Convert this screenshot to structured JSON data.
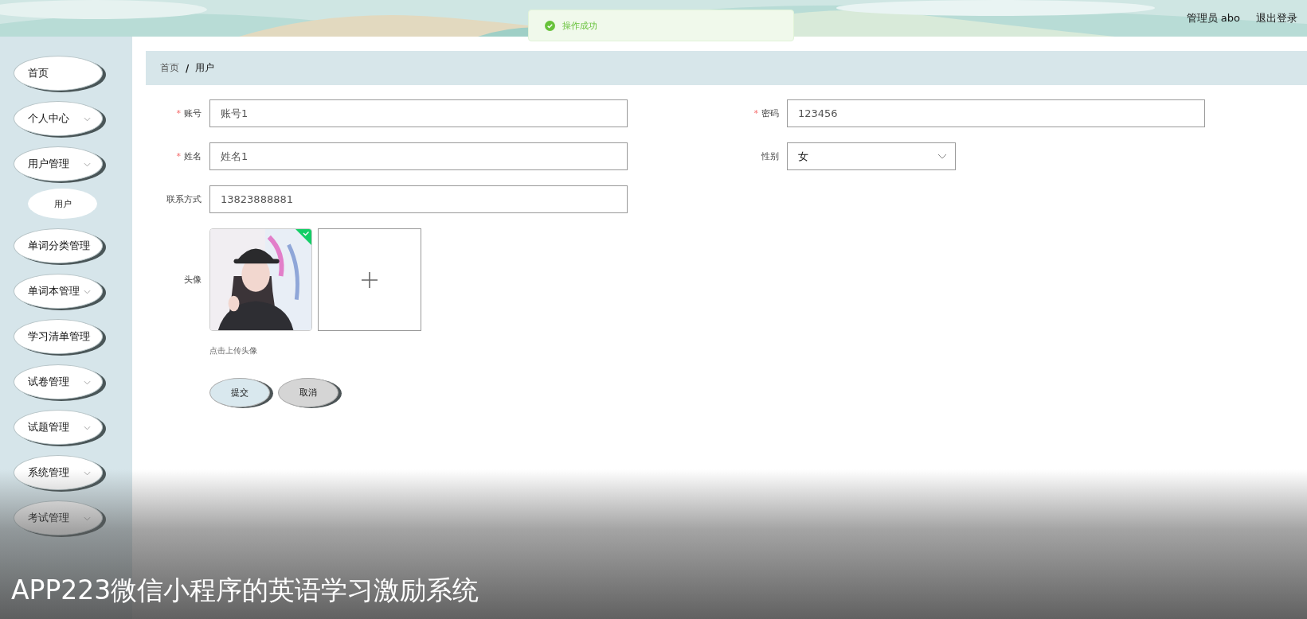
{
  "header": {
    "user": "管理员 abo",
    "logout": "退出登录"
  },
  "toast": {
    "message": "操作成功",
    "kind": "success"
  },
  "sidebar": {
    "items": [
      {
        "label": "首页",
        "kind": "link"
      },
      {
        "label": "个人中心",
        "kind": "submenu"
      },
      {
        "label": "用户管理",
        "kind": "submenu",
        "children": [
          {
            "label": "用户"
          }
        ]
      },
      {
        "label": "单词分类管理",
        "kind": "submenu"
      },
      {
        "label": "单词本管理",
        "kind": "submenu"
      },
      {
        "label": "学习清单管理",
        "kind": "submenu"
      },
      {
        "label": "试卷管理",
        "kind": "submenu"
      },
      {
        "label": "试题管理",
        "kind": "submenu"
      },
      {
        "label": "系统管理",
        "kind": "submenu"
      },
      {
        "label": "考试管理",
        "kind": "submenu"
      }
    ]
  },
  "breadcrumb": {
    "separator": "/",
    "items": [
      "首页",
      "用户"
    ]
  },
  "form": {
    "required_mark": "*",
    "rows": [
      [
        {
          "label": "账号",
          "required": true,
          "kind": "input",
          "value": "账号1"
        },
        {
          "label": "密码",
          "required": true,
          "kind": "input",
          "value": "123456"
        }
      ],
      [
        {
          "label": "姓名",
          "required": true,
          "kind": "input",
          "value": "姓名1"
        },
        {
          "label": "性别",
          "required": false,
          "kind": "select",
          "value": "女"
        }
      ],
      [
        {
          "label": "联系方式",
          "required": false,
          "kind": "input",
          "value": "13823888881"
        }
      ]
    ],
    "avatar": {
      "label": "头像",
      "hint": "点击上传头像"
    },
    "buttons": [
      {
        "label": "提交",
        "kind": "primary"
      },
      {
        "label": "取消",
        "kind": "default"
      }
    ]
  },
  "caption": "APP223微信小程序的英语学习激励系统"
}
